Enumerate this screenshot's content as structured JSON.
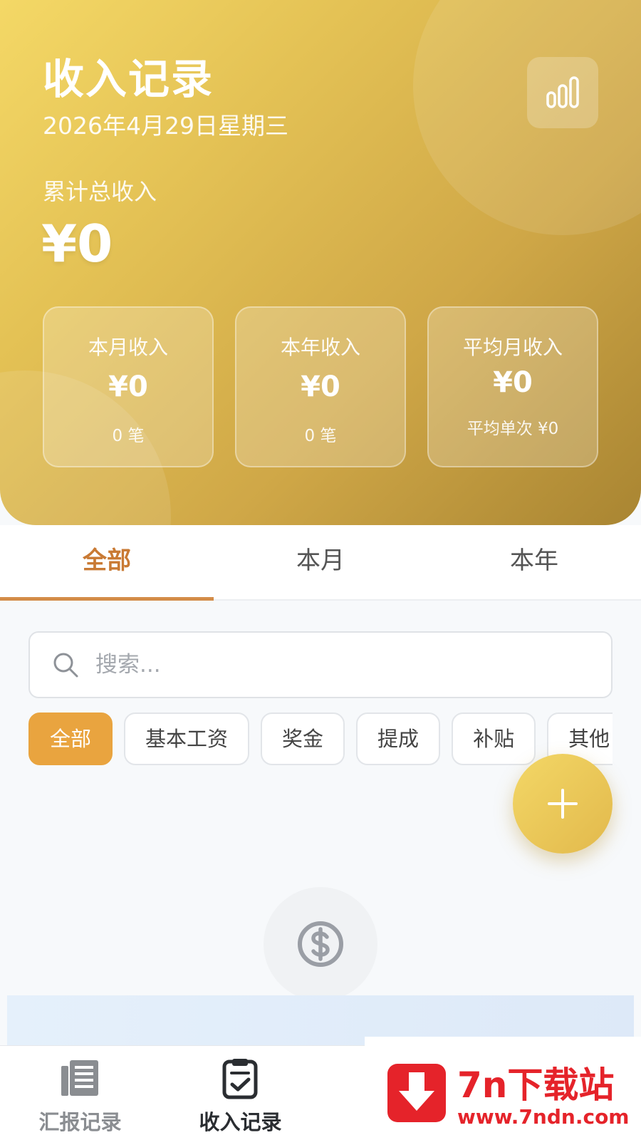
{
  "header": {
    "title": "收入记录",
    "date": "2026年4月29日星期三",
    "total_label": "累计总收入",
    "total_value": "¥0",
    "chart_button_icon": "bar-chart-icon"
  },
  "stats": [
    {
      "label": "本月收入",
      "value": "¥0",
      "sub": "0 笔"
    },
    {
      "label": "本年收入",
      "value": "¥0",
      "sub": "0 笔"
    },
    {
      "label": "平均月收入",
      "value": "¥0",
      "sub": "平均单次 ¥0"
    }
  ],
  "tabs": [
    {
      "label": "全部",
      "active": true
    },
    {
      "label": "本月",
      "active": false
    },
    {
      "label": "本年",
      "active": false
    }
  ],
  "search": {
    "placeholder": "搜索...",
    "icon": "search-icon"
  },
  "filters": [
    {
      "label": "全部",
      "active": true
    },
    {
      "label": "基本工资",
      "active": false
    },
    {
      "label": "奖金",
      "active": false
    },
    {
      "label": "提成",
      "active": false
    },
    {
      "label": "补贴",
      "active": false
    },
    {
      "label": "其他",
      "active": false
    }
  ],
  "fab": {
    "icon": "plus-icon"
  },
  "empty_state": {
    "icon": "dollar-icon"
  },
  "bottom_nav": [
    {
      "label": "汇报记录",
      "icon": "report-icon",
      "active": false
    },
    {
      "label": "收入记录",
      "icon": "checklist-icon",
      "active": true
    }
  ],
  "watermark": {
    "brand": "7n下载站",
    "url": "www.7ndn.com"
  },
  "colors": {
    "accent": "#e9a43f",
    "tab_active": "#c97a34",
    "header_gold": "#e4c255",
    "watermark_red": "#e5232a"
  }
}
